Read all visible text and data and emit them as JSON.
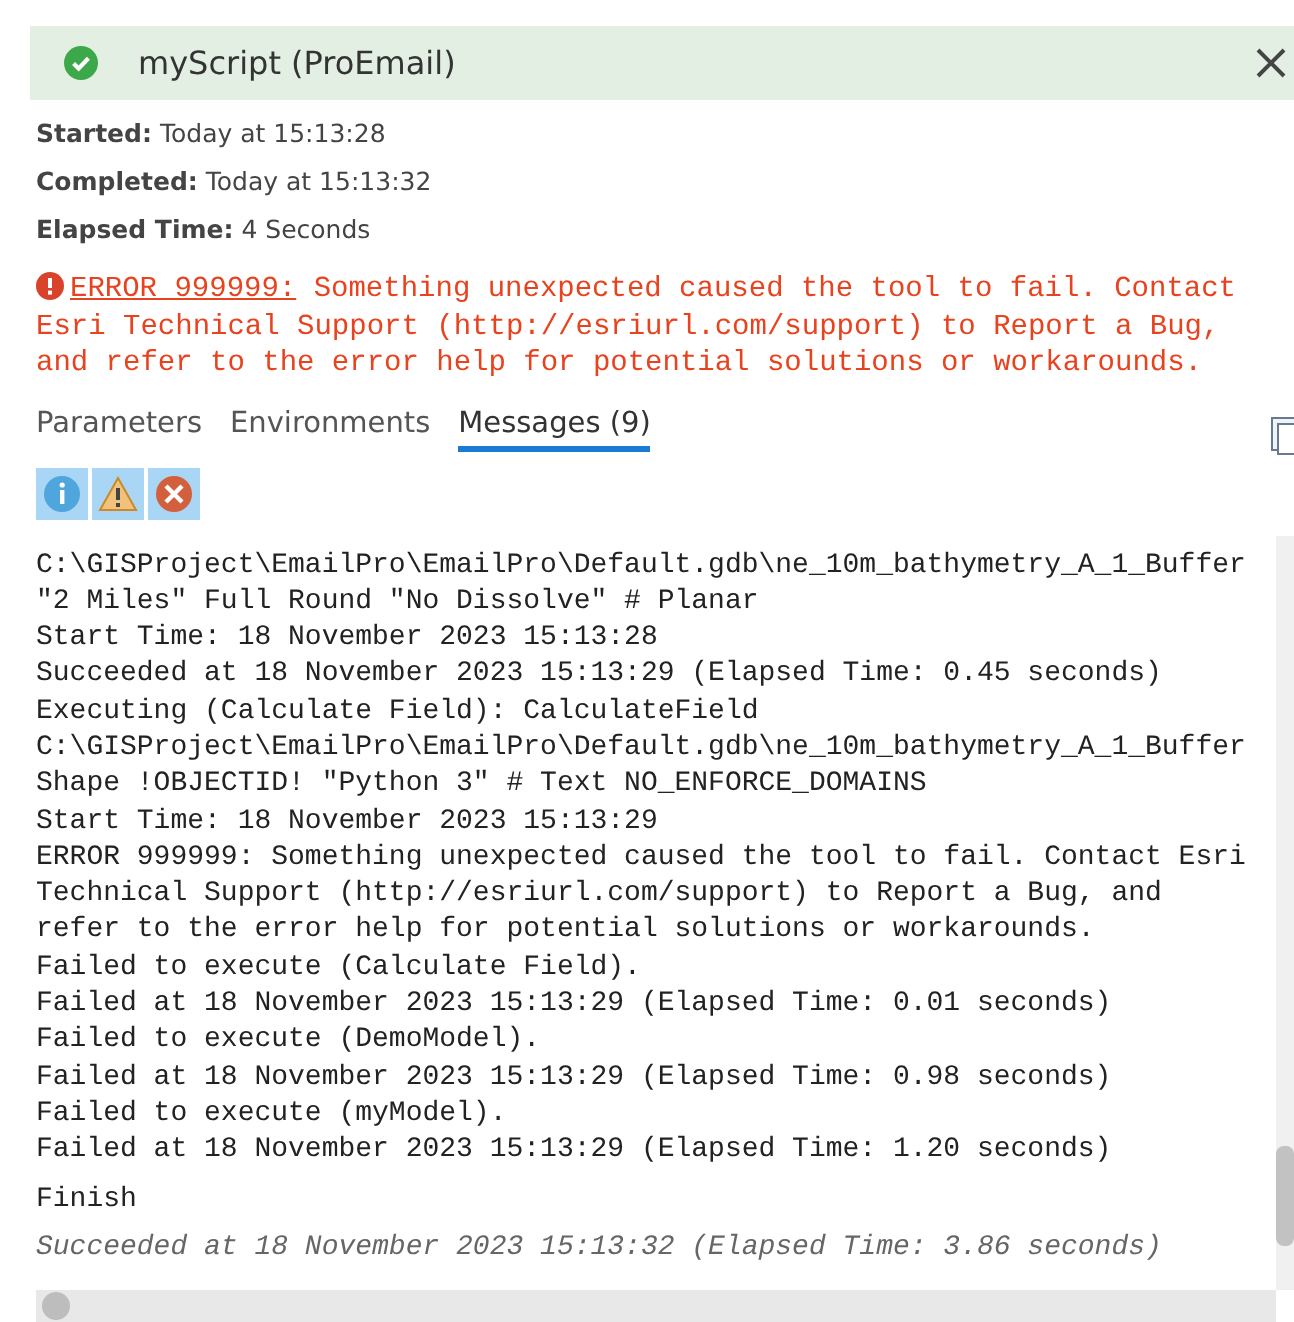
{
  "header": {
    "title": "myScript (ProEmail)",
    "succeeded": true
  },
  "details": [
    {
      "label": "Started:",
      "value": "Today at 15:13:28"
    },
    {
      "label": "Completed:",
      "value": "Today at 15:13:32"
    },
    {
      "label": "Elapsed Time:",
      "value": "4 Seconds"
    }
  ],
  "error": {
    "code": "ERROR 999999:",
    "message": "Something unexpected caused the tool to fail. Contact Esri Technical Support (http://esriurl.com/support) to Report a Bug, and refer to the error help for potential solutions or workarounds."
  },
  "tabs": [
    {
      "label": "Parameters",
      "selected": false
    },
    {
      "label": "Environments",
      "selected": false
    },
    {
      "label": "Messages (9)",
      "selected": true
    }
  ],
  "filters": [
    {
      "kind": "info",
      "on": true
    },
    {
      "kind": "warning",
      "on": true
    },
    {
      "kind": "error",
      "on": true
    }
  ],
  "messages": [
    {
      "kind": "line",
      "text": "C:\\GISProject\\EmailPro\\EmailPro\\Default.gdb\\ne_10m_bathymetry_A_1_Buffer"
    },
    {
      "kind": "line",
      "text": "\"2 Miles\" Full Round \"No Dissolve\" # Planar"
    },
    {
      "kind": "line",
      "text": "Start Time: 18 November 2023 15:13:28"
    },
    {
      "kind": "line",
      "text": "Succeeded at 18 November 2023 15:13:29 (Elapsed Time: 0.45 seconds)"
    },
    {
      "kind": "line",
      "text": "Executing (Calculate Field): CalculateField"
    },
    {
      "kind": "line",
      "text": "C:\\GISProject\\EmailPro\\EmailPro\\Default.gdb\\ne_10m_bathymetry_A_1_Buffer"
    },
    {
      "kind": "line",
      "text": "Shape !OBJECTID! \"Python 3\" # Text NO_ENFORCE_DOMAINS"
    },
    {
      "kind": "line",
      "text": "Start Time: 18 November 2023 15:13:29"
    },
    {
      "kind": "line",
      "text": "ERROR 999999: Something unexpected caused the tool to fail. Contact Esri"
    },
    {
      "kind": "line",
      "text": "Technical Support (http://esriurl.com/support) to Report a Bug, and"
    },
    {
      "kind": "line",
      "text": "refer to the error help for potential solutions or workarounds."
    },
    {
      "kind": "line",
      "text": "Failed to execute (Calculate Field)."
    },
    {
      "kind": "line",
      "text": "Failed at 18 November 2023 15:13:29 (Elapsed Time: 0.01 seconds)"
    },
    {
      "kind": "line",
      "text": "Failed to execute (DemoModel)."
    },
    {
      "kind": "line",
      "text": "Failed at 18 November 2023 15:13:29 (Elapsed Time: 0.98 seconds)"
    },
    {
      "kind": "line",
      "text": "Failed to execute (myModel)."
    },
    {
      "kind": "line",
      "text": "Failed at 18 November 2023 15:13:29 (Elapsed Time: 1.20 seconds)"
    },
    {
      "kind": "finish",
      "text": "Finish"
    },
    {
      "kind": "summary",
      "text": "Succeeded at 18 November 2023 15:13:32 (Elapsed Time: 3.86 seconds)"
    }
  ]
}
